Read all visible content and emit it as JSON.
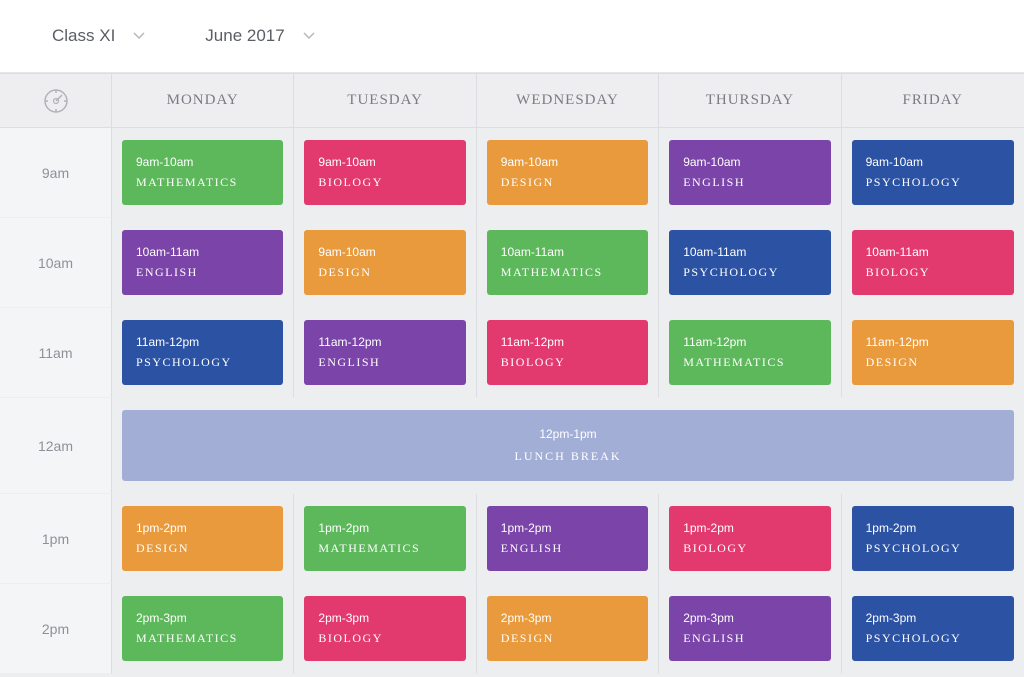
{
  "filters": {
    "class": "Class XI",
    "month": "June 2017"
  },
  "days": [
    "MONDAY",
    "TUESDAY",
    "WEDNESDAY",
    "THURSDAY",
    "FRIDAY"
  ],
  "times": [
    "9am",
    "10am",
    "11am",
    "12am",
    "1pm",
    "2pm"
  ],
  "lunch": {
    "time": "12pm-1pm",
    "label": "LUNCH BREAK",
    "color": "c-lavender"
  },
  "subjects": {
    "math": {
      "name": "MATHEMATICS",
      "color": "c-green"
    },
    "bio": {
      "name": "BIOLOGY",
      "color": "c-pink"
    },
    "design": {
      "name": "DESIGN",
      "color": "c-orange"
    },
    "eng": {
      "name": "ENGLISH",
      "color": "c-purple"
    },
    "psy": {
      "name": "PSYCHOLOGY",
      "color": "c-blue"
    }
  },
  "grid": [
    [
      {
        "t": "9am-10am",
        "s": "math"
      },
      {
        "t": "9am-10am",
        "s": "bio"
      },
      {
        "t": "9am-10am",
        "s": "design"
      },
      {
        "t": "9am-10am",
        "s": "eng"
      },
      {
        "t": "9am-10am",
        "s": "psy"
      }
    ],
    [
      {
        "t": "10am-11am",
        "s": "eng"
      },
      {
        "t": "9am-10am",
        "s": "design"
      },
      {
        "t": "10am-11am",
        "s": "math"
      },
      {
        "t": "10am-11am",
        "s": "psy"
      },
      {
        "t": "10am-11am",
        "s": "bio"
      }
    ],
    [
      {
        "t": "11am-12pm",
        "s": "psy"
      },
      {
        "t": "11am-12pm",
        "s": "eng"
      },
      {
        "t": "11am-12pm",
        "s": "bio"
      },
      {
        "t": "11am-12pm",
        "s": "math"
      },
      {
        "t": "11am-12pm",
        "s": "design"
      }
    ],
    "lunch",
    [
      {
        "t": "1pm-2pm",
        "s": "design"
      },
      {
        "t": "1pm-2pm",
        "s": "math"
      },
      {
        "t": "1pm-2pm",
        "s": "eng"
      },
      {
        "t": "1pm-2pm",
        "s": "bio"
      },
      {
        "t": "1pm-2pm",
        "s": "psy"
      }
    ],
    [
      {
        "t": "2pm-3pm",
        "s": "math"
      },
      {
        "t": "2pm-3pm",
        "s": "bio"
      },
      {
        "t": "2pm-3pm",
        "s": "design"
      },
      {
        "t": "2pm-3pm",
        "s": "eng"
      },
      {
        "t": "2pm-3pm",
        "s": "psy"
      }
    ]
  ]
}
